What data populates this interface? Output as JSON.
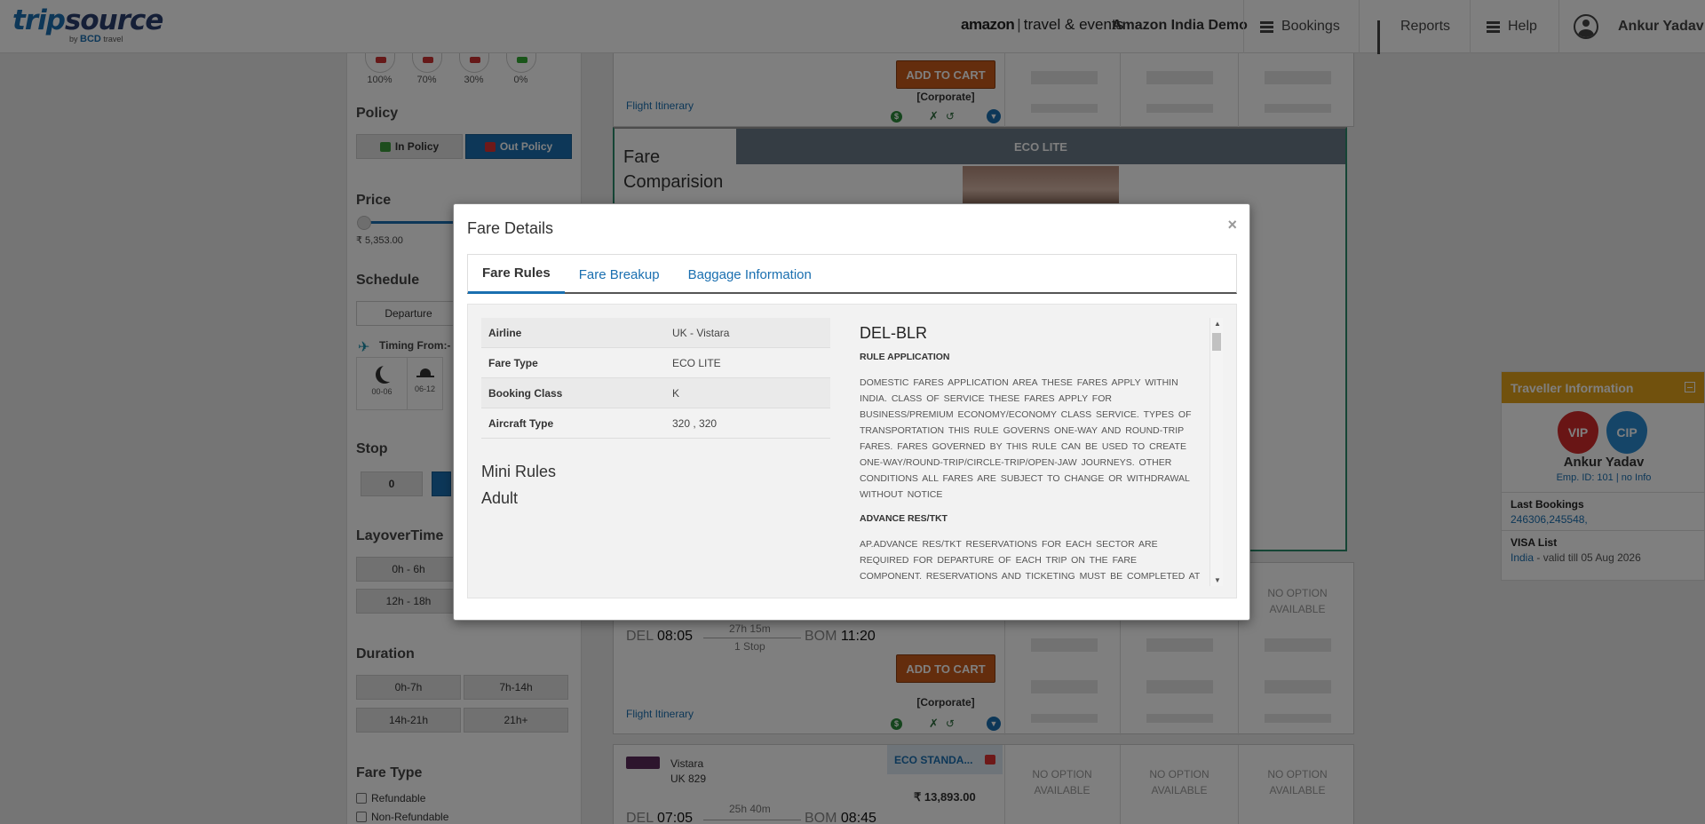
{
  "header": {
    "logo_main_1": "trip",
    "logo_main_2": "source",
    "logo_sub_by": "by",
    "logo_sub_bcd": "BCD",
    "logo_sub_travel": "travel",
    "brand_amazon": "amazon",
    "brand_divider": "|",
    "brand_travel": "travel & events",
    "company": "Amazon India Demo",
    "nav": {
      "bookings": "Bookings",
      "reports": "Reports",
      "help": "Help",
      "user": "Ankur Yadav"
    }
  },
  "sidebar": {
    "percent_filters": [
      "100%",
      "70%",
      "30%",
      "0%"
    ],
    "policy_title": "Policy",
    "in_policy": "In Policy",
    "out_policy": "Out Policy",
    "price_title": "Price",
    "price_min": "₹ 5,353.00",
    "schedule_title": "Schedule",
    "departure_tab": "Departure",
    "timing_from": "Timing From:- D",
    "time_slots": [
      "00-06",
      "06-12"
    ],
    "stop_title": "Stop",
    "stop_zero": "0",
    "layover_title": "LayoverTime",
    "layover_options": [
      "0h - 6h",
      "12h - 18h"
    ],
    "duration_title": "Duration",
    "duration_options": [
      "0h-7h",
      "7h-14h",
      "14h-21h",
      "21h+"
    ],
    "fare_type_title": "Fare Type",
    "fare_type_options": [
      "Refundable",
      "Non-Refundable"
    ]
  },
  "results": {
    "add_to_cart": "ADD TO CART",
    "corporate": "[Corporate]",
    "flight_itinerary": "Flight Itinerary",
    "fare_comparison_title": "Fare Comparision",
    "fare_comparison_col": "ECO LITE",
    "no_option_line1": "NO OPTION",
    "no_option_line2": "AVAILABLE",
    "flight2": {
      "from": "DEL",
      "dep": "08:05",
      "duration": "27h 15m",
      "stops": "1 Stop",
      "to": "BOM",
      "arr": "11:20"
    },
    "flight3": {
      "airline": "Vistara",
      "flight_no": "UK  829",
      "fare_label": "ECO STANDA...",
      "price": "₹ 13,893.00",
      "from": "DEL",
      "dep": "07:05",
      "duration": "25h 40m",
      "to": "BOM",
      "arr": "08:45"
    }
  },
  "traveller": {
    "title": "Traveller Information",
    "badge_vip": "VIP",
    "badge_cip": "CIP",
    "name": "Ankur Yadav",
    "emp": "Emp. ID: 101 | no Info",
    "last_bookings_label": "Last Bookings",
    "last_bookings_value": "246306,245548,",
    "visa_label": "VISA List",
    "visa_country": "India",
    "visa_valid": " - valid till 05 Aug 2026"
  },
  "modal": {
    "title": "Fare Details",
    "close": "×",
    "tabs": [
      "Fare Rules",
      "Fare Breakup",
      "Baggage Information"
    ],
    "info": [
      {
        "k": "Airline",
        "v": "UK - Vistara"
      },
      {
        "k": "Fare Type",
        "v": "ECO LITE"
      },
      {
        "k": "Booking Class",
        "v": "K"
      },
      {
        "k": "Aircraft Type",
        "v": "320 , 320"
      }
    ],
    "mini_rules": "Mini Rules",
    "adult": "Adult",
    "route": "DEL-BLR",
    "rule_app_title": "RULE APPLICATION",
    "rule_app_text": "DOMESTIC FARES  APPLICATION    AREA     THESE FARES APPLY     WITHIN INDIA.    CLASS OF SERVICE     THESE FARES APPLY FOR BUSINESS/PREMIUM ECONOMY/ECONOMY     CLASS SERVICE.    TYPES OF TRANSPORTATION     THIS RULE GOVERNS ONE-WAY AND ROUND-TRIP FARES.     FARES GOVERNED BY THIS RULE CAN BE USED TO CREATE ONE-WAY/ROUND-TRIP/CIRCLE-TRIP/OPEN-JAW JOURNEYS.  OTHER CONDITIONS    ALL FARES ARE SUBJECT TO CHANGE OR WITHDRAWAL WITHOUT NOTICE",
    "advance_title": "ADVANCE RES/TKT",
    "advance_text": "AP.ADVANCE RES/TKT    RESERVATIONS FOR EACH SECTOR ARE REQUIRED FOR DEPARTURE OF   EACH TRIP ON THE FARE COMPONENT.    RESERVATIONS AND TICKETING MUST BE COMPLETED AT THE SAME"
  },
  "colors": {
    "accent": "#1a6fb0",
    "cart": "#c85a1a",
    "traveller_header": "#e3a31a",
    "fare_header": "#6a7a89"
  }
}
